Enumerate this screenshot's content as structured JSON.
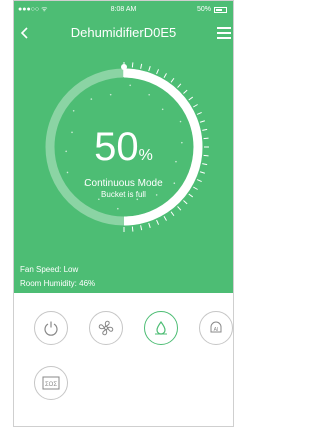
{
  "status_bar": {
    "left": "●●●○○ ᯤ",
    "time": "8:08 AM",
    "battery": "50%"
  },
  "header": {
    "title": "DehumidifierD0E5"
  },
  "gauge": {
    "percent": 50,
    "percent_value": "50",
    "percent_unit": "%",
    "mode": "Continuous Mode",
    "status": "Bucket is full"
  },
  "info": {
    "fan_speed": "Fan Speed: Low",
    "room_humidity": "Room Humidity: 46%"
  },
  "controls": [
    {
      "name": "power",
      "icon": "power-icon",
      "active": false
    },
    {
      "name": "fan",
      "icon": "fan-icon",
      "active": false
    },
    {
      "name": "drop",
      "icon": "drop-icon",
      "active": true
    },
    {
      "name": "ai",
      "icon": "ai-bell-icon",
      "label": "AI",
      "active": false
    },
    {
      "name": "filter",
      "icon": "filter-icon",
      "label": "ΣOΣ",
      "active": false
    }
  ],
  "colors": {
    "background": "#4dbd74",
    "active": "#4dbd74",
    "inactive": "#c6c6c6"
  }
}
